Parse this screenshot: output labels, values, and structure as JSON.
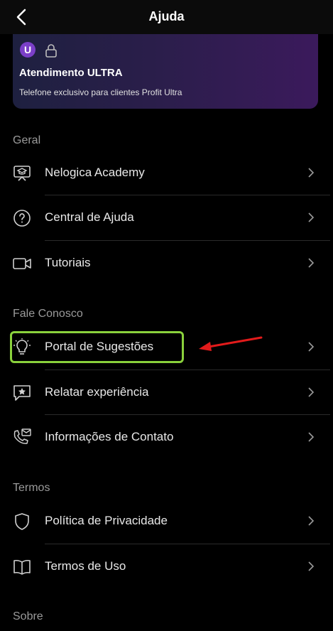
{
  "header": {
    "title": "Ajuda"
  },
  "ultra": {
    "badge": "U",
    "title": "Atendimento ULTRA",
    "subtitle": "Telefone exclusivo para clientes Profit Ultra"
  },
  "sections": {
    "geral": "Geral",
    "fale": "Fale Conosco",
    "termos": "Termos",
    "sobre": "Sobre"
  },
  "items": {
    "academy": "Nelogica Academy",
    "central": "Central de Ajuda",
    "tutoriais": "Tutoriais",
    "portal": "Portal de Sugestões",
    "relatar": "Relatar experiência",
    "contato": "Informações de Contato",
    "privacidade": "Política de Privacidade",
    "termos_uso": "Termos de Uso"
  },
  "colors": {
    "highlight": "#8ad13c",
    "arrow": "#e21b1b",
    "ultra_badge": "#7b3fc8"
  }
}
